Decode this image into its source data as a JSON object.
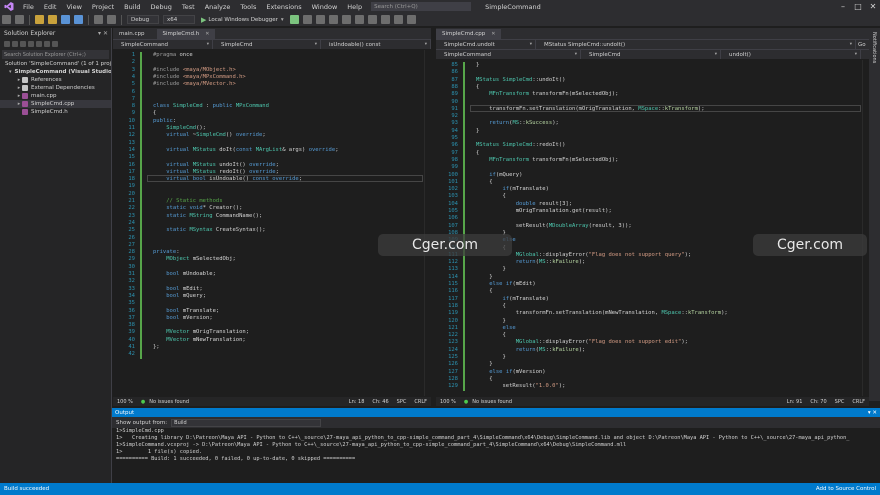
{
  "menubar": {
    "items": [
      "File",
      "Edit",
      "View",
      "Project",
      "Build",
      "Debug",
      "Test",
      "Analyze",
      "Tools",
      "Extensions",
      "Window",
      "Help"
    ],
    "search_placeholder": "Search (Ctrl+Q)",
    "solution_title": "SimpleCommand"
  },
  "toolbar": {
    "config": "Debug",
    "platform": "x64",
    "run_label": "Local Windows Debugger",
    "go_label": "Go"
  },
  "solution_explorer": {
    "title": "Solution Explorer",
    "search_placeholder": "Search Solution Explorer (Ctrl+;)",
    "items": [
      {
        "label": "Solution 'SimpleCommand' (1 of 1 project)",
        "bold": false,
        "indent": 0,
        "chev": "",
        "icon_color": "#9b9b9b"
      },
      {
        "label": "SimpleCommand (Visual Studio 2",
        "bold": true,
        "indent": 1,
        "chev": "▾",
        "icon_color": "#68217a"
      },
      {
        "label": "References",
        "bold": false,
        "indent": 2,
        "chev": "▸",
        "icon_color": "#c5c5c5"
      },
      {
        "label": "External Dependencies",
        "bold": false,
        "indent": 2,
        "chev": "▸",
        "icon_color": "#c5c5c5"
      },
      {
        "label": "main.cpp",
        "bold": false,
        "indent": 2,
        "chev": "▸",
        "icon_color": "#9b4f96"
      },
      {
        "label": "SimpleCmd.cpp",
        "bold": false,
        "indent": 2,
        "chev": "▸",
        "icon_color": "#9b4f96",
        "selected": true
      },
      {
        "label": "SimpleCmd.h",
        "bold": false,
        "indent": 2,
        "chev": "",
        "icon_color": "#9b4f96"
      }
    ]
  },
  "left_editor": {
    "tabs": [
      {
        "label": "main.cpp",
        "active": false
      },
      {
        "label": "SimpleCmd.h",
        "active": true
      }
    ],
    "nav": [
      "SimpleCommand",
      "SimpleCmd",
      "isUndoable() const"
    ],
    "lines": [
      {
        "n": "1",
        "t": "#pragma once"
      },
      {
        "n": "2",
        "t": ""
      },
      {
        "n": "3",
        "t": "#include <maya/MObject.h>"
      },
      {
        "n": "4",
        "t": "#include <maya/MPxCommand.h>"
      },
      {
        "n": "5",
        "t": "#include <maya/MVector.h>"
      },
      {
        "n": "6",
        "t": ""
      },
      {
        "n": "7",
        "t": ""
      },
      {
        "n": "8",
        "t": "class SimpleCmd : public MPxCommand"
      },
      {
        "n": "9",
        "t": "{"
      },
      {
        "n": "10",
        "t": "public:"
      },
      {
        "n": "11",
        "t": "    SimpleCmd();"
      },
      {
        "n": "12",
        "t": "    virtual ~SimpleCmd() override;"
      },
      {
        "n": "13",
        "t": ""
      },
      {
        "n": "14",
        "t": "    virtual MStatus doIt(const MArgList& args) override;"
      },
      {
        "n": "15",
        "t": ""
      },
      {
        "n": "16",
        "t": "    virtual MStatus undoIt() override;"
      },
      {
        "n": "17",
        "t": "    virtual MStatus redoIt() override;"
      },
      {
        "n": "18",
        "t": "    virtual bool isUndoable() const override;"
      },
      {
        "n": "19",
        "t": ""
      },
      {
        "n": "20",
        "t": ""
      },
      {
        "n": "21",
        "t": "    // Static methods"
      },
      {
        "n": "22",
        "t": "    static void* Creator();"
      },
      {
        "n": "23",
        "t": "    static MString CommandName();"
      },
      {
        "n": "24",
        "t": ""
      },
      {
        "n": "25",
        "t": "    static MSyntax CreateSyntax();"
      },
      {
        "n": "26",
        "t": ""
      },
      {
        "n": "27",
        "t": ""
      },
      {
        "n": "28",
        "t": "private:"
      },
      {
        "n": "29",
        "t": "    MObject mSelectedObj;"
      },
      {
        "n": "30",
        "t": ""
      },
      {
        "n": "31",
        "t": "    bool mUndoable;"
      },
      {
        "n": "32",
        "t": ""
      },
      {
        "n": "33",
        "t": "    bool mEdit;"
      },
      {
        "n": "34",
        "t": "    bool mQuery;"
      },
      {
        "n": "35",
        "t": ""
      },
      {
        "n": "36",
        "t": "    bool mTranslate;"
      },
      {
        "n": "37",
        "t": "    bool mVersion;"
      },
      {
        "n": "38",
        "t": ""
      },
      {
        "n": "39",
        "t": "    MVector mOrigTranslation;"
      },
      {
        "n": "40",
        "t": "    MVector mNewTranslation;"
      },
      {
        "n": "41",
        "t": "};"
      },
      {
        "n": "42",
        "t": ""
      }
    ],
    "status": {
      "zoom": "100 %",
      "issues": "No issues found",
      "ln": "Ln: 18",
      "ch": "Ch: 46",
      "spc": "SPC",
      "crlf": "CRLF"
    }
  },
  "right_editor": {
    "tabs": [
      {
        "label": "SimpleCmd.cpp",
        "active": true
      }
    ],
    "nav": [
      "SimpleCmd.undoIt",
      "MStatus SimpleCmd::undoIt()"
    ],
    "nav2": [
      "SimpleCommand",
      "SimpleCmd",
      "undoIt()"
    ],
    "lines": [
      {
        "n": "85",
        "t": "}"
      },
      {
        "n": "86",
        "t": ""
      },
      {
        "n": "87",
        "t": "MStatus SimpleCmd::undoIt()"
      },
      {
        "n": "88",
        "t": "{"
      },
      {
        "n": "89",
        "t": "    MFnTransform transformFn(mSelectedObj);"
      },
      {
        "n": "90",
        "t": ""
      },
      {
        "n": "91",
        "t": "    transformFn.setTranslation(mOrigTranslation, MSpace::kTransform);"
      },
      {
        "n": "92",
        "t": ""
      },
      {
        "n": "93",
        "t": "    return(MS::kSuccess);"
      },
      {
        "n": "94",
        "t": "}"
      },
      {
        "n": "95",
        "t": ""
      },
      {
        "n": "96",
        "t": "MStatus SimpleCmd::redoIt()"
      },
      {
        "n": "97",
        "t": "{"
      },
      {
        "n": "98",
        "t": "    MFnTransform transformFn(mSelectedObj);"
      },
      {
        "n": "99",
        "t": ""
      },
      {
        "n": "100",
        "t": "    if(mQuery)"
      },
      {
        "n": "101",
        "t": "    {"
      },
      {
        "n": "102",
        "t": "        if(mTranslate)"
      },
      {
        "n": "103",
        "t": "        {"
      },
      {
        "n": "104",
        "t": "            double result[3];"
      },
      {
        "n": "105",
        "t": "            mOrigTranslation.get(result);"
      },
      {
        "n": "106",
        "t": ""
      },
      {
        "n": "107",
        "t": "            setResult(MDoubleArray(result, 3));"
      },
      {
        "n": "108",
        "t": "        }"
      },
      {
        "n": "109",
        "t": "        else"
      },
      {
        "n": "110",
        "t": "        {"
      },
      {
        "n": "111",
        "t": "            MGlobal::displayError(\"Flag does not support query\");"
      },
      {
        "n": "112",
        "t": "            return(MS::kFailure);"
      },
      {
        "n": "113",
        "t": "        }"
      },
      {
        "n": "114",
        "t": "    }"
      },
      {
        "n": "115",
        "t": "    else if(mEdit)"
      },
      {
        "n": "116",
        "t": "    {"
      },
      {
        "n": "117",
        "t": "        if(mTranslate)"
      },
      {
        "n": "118",
        "t": "        {"
      },
      {
        "n": "119",
        "t": "            transformFn.setTranslation(mNewTranslation, MSpace::kTransform);"
      },
      {
        "n": "120",
        "t": "        }"
      },
      {
        "n": "121",
        "t": "        else"
      },
      {
        "n": "122",
        "t": "        {"
      },
      {
        "n": "123",
        "t": "            MGlobal::displayError(\"Flag does not support edit\");"
      },
      {
        "n": "124",
        "t": "            return(MS::kFailure);"
      },
      {
        "n": "125",
        "t": "        }"
      },
      {
        "n": "126",
        "t": "    }"
      },
      {
        "n": "127",
        "t": "    else if(mVersion)"
      },
      {
        "n": "128",
        "t": "    {"
      },
      {
        "n": "129",
        "t": "        setResult(\"1.0.0\");"
      }
    ],
    "status": {
      "zoom": "100 %",
      "issues": "No issues found",
      "ln": "Ln: 91",
      "ch": "Ch: 70",
      "spc": "SPC",
      "crlf": "CRLF"
    }
  },
  "right_strip_label": "Notifications",
  "output": {
    "title": "Output",
    "show_from_label": "Show output from:",
    "show_from_value": "Build",
    "lines": [
      "1>SimpleCmd.cpp",
      "1>   Creating library D:\\Patreon\\Maya API - Python to C++\\_source\\27-maya_api_python_to_cpp-simple_command_part_4\\SimpleCommand\\x64\\Debug\\SimpleCommand.lib and object D:\\Patreon\\Maya API - Python to C++\\_source\\27-maya_api_python_",
      "1>SimpleCommand.vcxproj -> D:\\Patreon\\Maya API - Python to C++\\_source\\27-maya_api_python_to_cpp-simple_command_part_4\\SimpleCommand\\x64\\Debug\\SimpleCommand.mll",
      "1>        1 file(s) copied.",
      "========== Build: 1 succeeded, 0 failed, 0 up-to-date, 0 skipped =========="
    ]
  },
  "statusbar": {
    "left": "Build succeeded",
    "right": "Add to Source Control"
  },
  "watermark": "Cger.com"
}
